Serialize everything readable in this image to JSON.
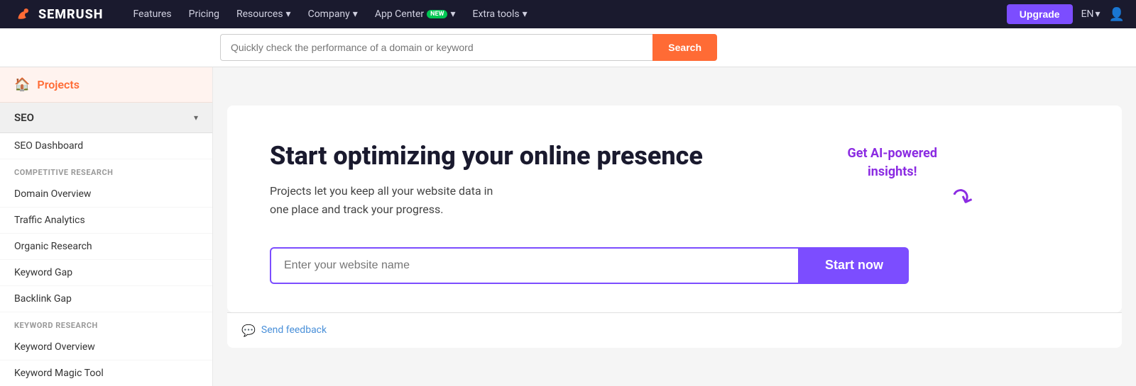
{
  "topnav": {
    "logo_text": "SEMRUSH",
    "links": [
      {
        "label": "Features",
        "has_dropdown": false
      },
      {
        "label": "Pricing",
        "has_dropdown": false
      },
      {
        "label": "Resources",
        "has_dropdown": true
      },
      {
        "label": "Company",
        "has_dropdown": true
      },
      {
        "label": "App Center",
        "has_dropdown": true,
        "badge": "new"
      },
      {
        "label": "Extra tools",
        "has_dropdown": true
      }
    ],
    "upgrade_label": "Upgrade",
    "lang_label": "EN",
    "chevron": "▾"
  },
  "searchbar": {
    "placeholder": "Quickly check the performance of a domain or keyword",
    "button_label": "Search"
  },
  "sidebar": {
    "projects_label": "Projects",
    "seo_label": "SEO",
    "seo_chevron": "▾",
    "seo_dashboard_label": "SEO Dashboard",
    "competitive_research_label": "COMPETITIVE RESEARCH",
    "competitive_items": [
      {
        "label": "Domain Overview"
      },
      {
        "label": "Traffic Analytics"
      },
      {
        "label": "Organic Research"
      },
      {
        "label": "Keyword Gap"
      },
      {
        "label": "Backlink Gap"
      }
    ],
    "keyword_research_label": "KEYWORD RESEARCH",
    "keyword_items": [
      {
        "label": "Keyword Overview"
      },
      {
        "label": "Keyword Magic Tool"
      }
    ]
  },
  "hero": {
    "title": "Start optimizing your online presence",
    "description_line1": "Projects let you keep all your website data in",
    "description_line2": "one place and track your progress.",
    "ai_badge_line1": "Get AI-powered",
    "ai_badge_line2": "insights!",
    "input_placeholder": "Enter your website name",
    "start_now_label": "Start now"
  },
  "feedback": {
    "link_label": "Send feedback",
    "icon": "□"
  }
}
